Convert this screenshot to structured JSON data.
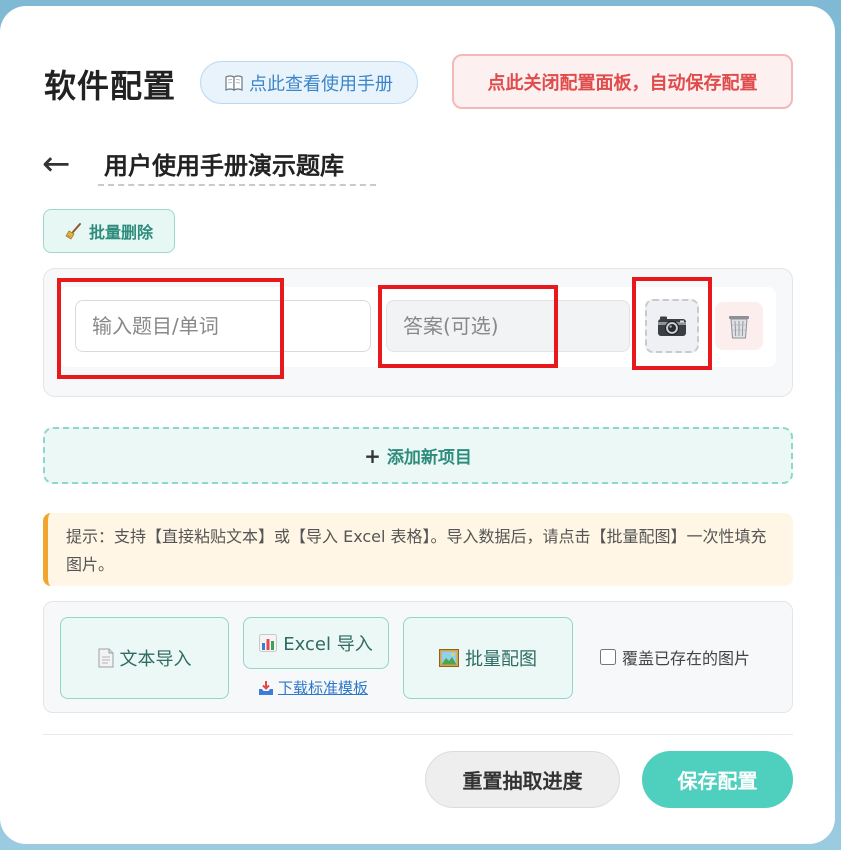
{
  "header": {
    "title": "软件配置",
    "manual_label": "点此查看使用手册",
    "manual_icon": "book-icon",
    "close_label": "点此关闭配置面板，自动保存配置"
  },
  "deck": {
    "back_icon": "left-arrow-icon",
    "back_glyph": "←",
    "title_value": "用户使用手册演示题库"
  },
  "toolbar": {
    "batch_delete_label": "批量删除",
    "batch_delete_icon": "broom-icon"
  },
  "items": [
    {
      "question_value": "",
      "question_placeholder": "输入题目/单词",
      "answer_value": "",
      "answer_placeholder": "答案(可选)",
      "image_icon": "camera-icon",
      "delete_icon": "trash-icon"
    }
  ],
  "add_item": {
    "plus": "+",
    "label": "添加新项目"
  },
  "tip": {
    "text": "提示：支持【直接粘贴文本】或【导入 Excel 表格】。导入数据后，请点击【批量配图】一次性填充图片。"
  },
  "import": {
    "text_import_label": "文本导入",
    "text_import_icon": "document-icon",
    "excel_import_label": "Excel 导入",
    "excel_import_icon": "bar-chart-icon",
    "download_template_label": "下载标准模板",
    "download_icon": "download-tray-icon",
    "batch_image_label": "批量配图",
    "batch_image_icon": "picture-icon",
    "overwrite_label": "覆盖已存在的图片",
    "overwrite_checked": false
  },
  "footer": {
    "reset_label": "重置抽取进度",
    "save_label": "保存配置"
  },
  "colors": {
    "accent_teal": "#4fcfbd",
    "danger_red": "#e04b4b",
    "annotation_red": "#e8191c",
    "warning_orange": "#f2a52e"
  }
}
